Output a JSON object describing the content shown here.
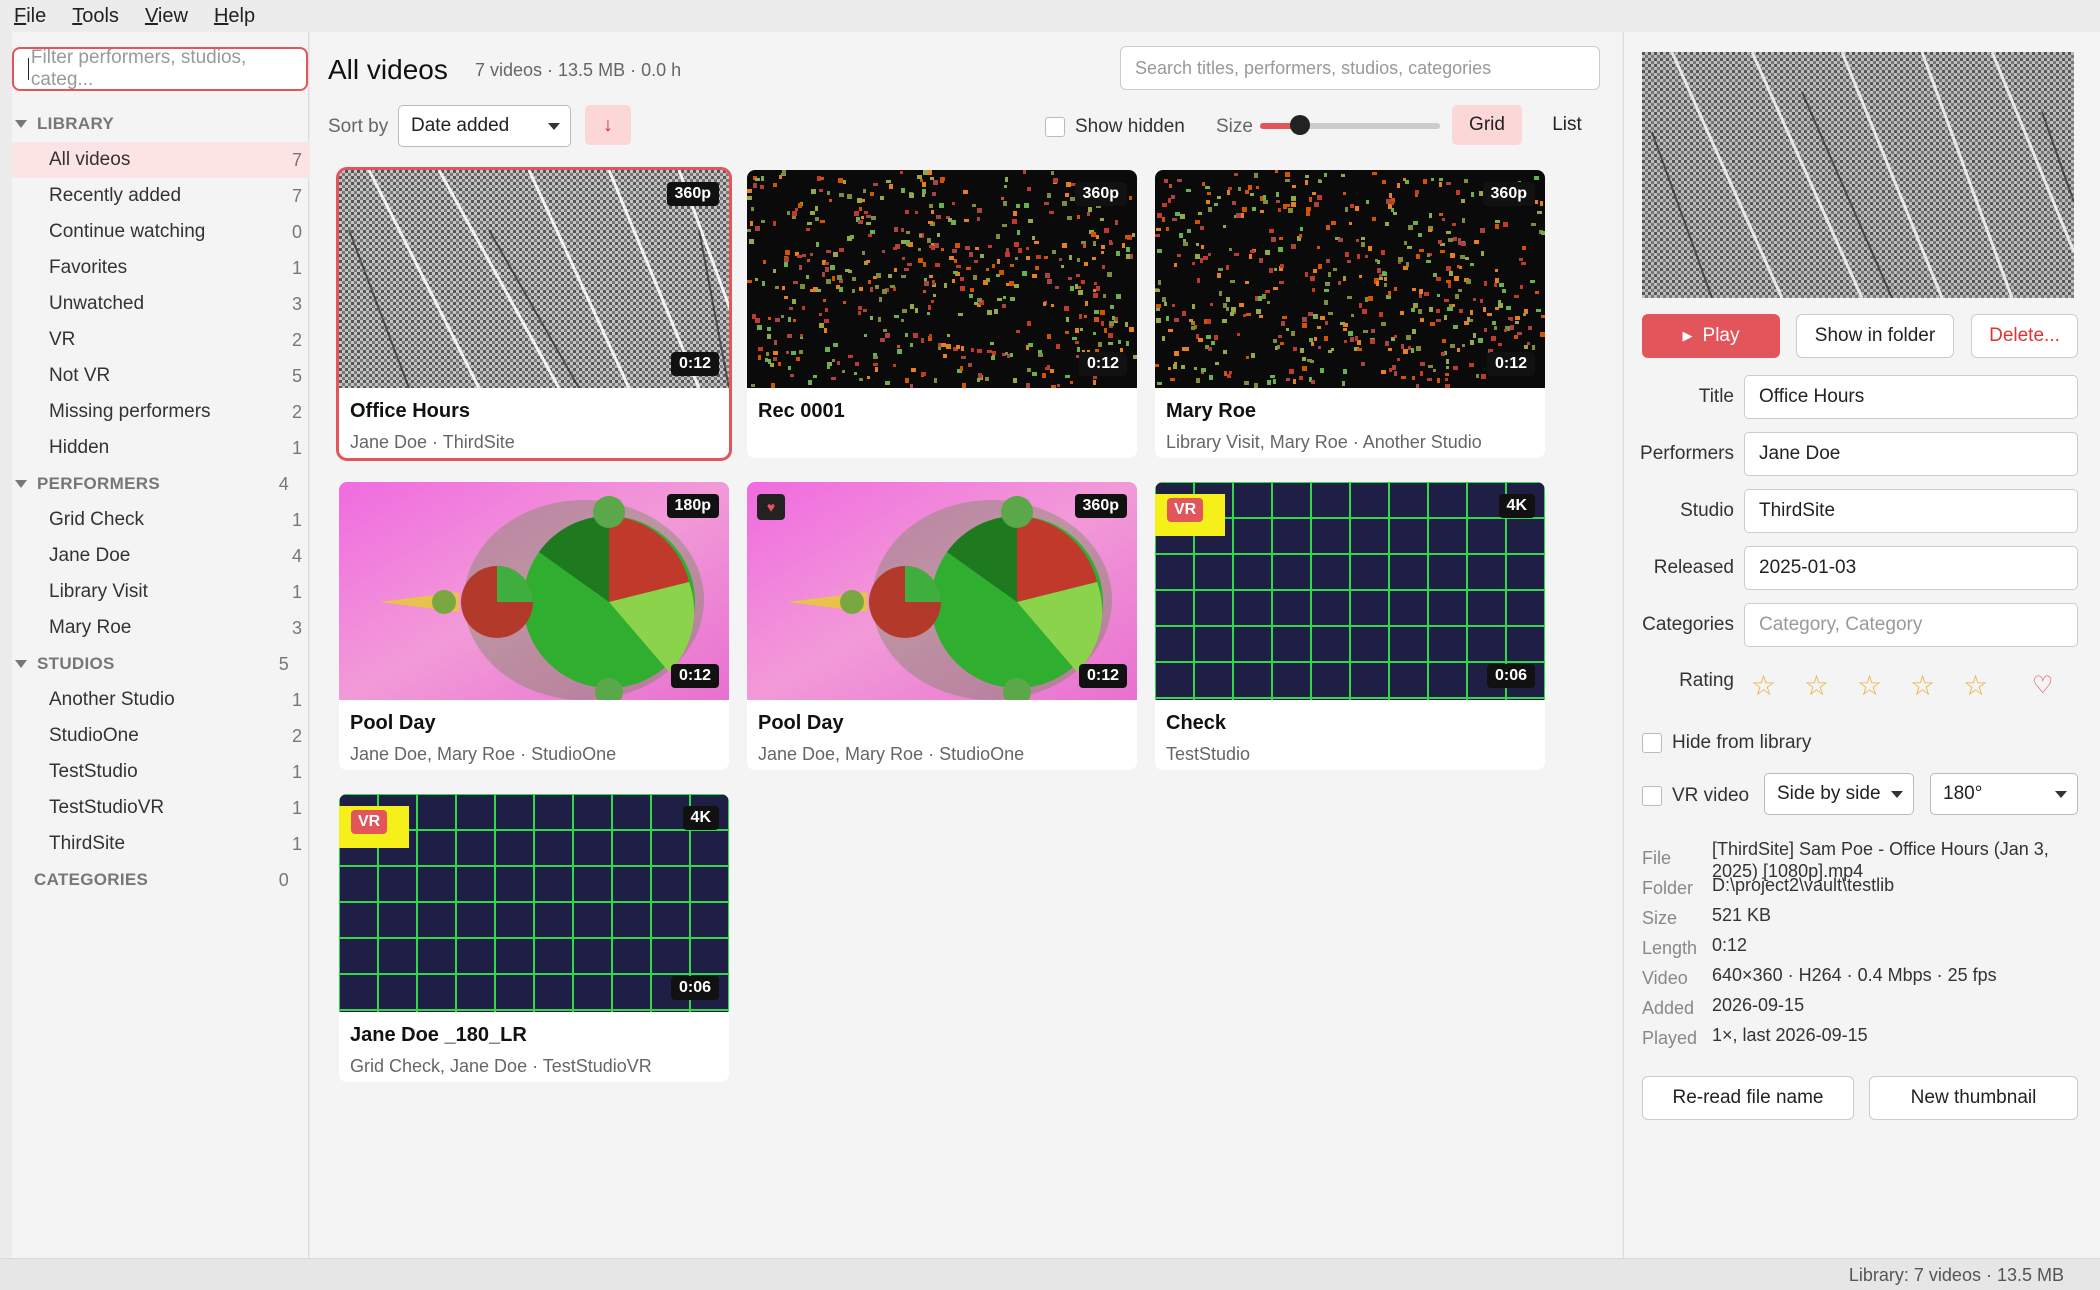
{
  "menu": [
    "File",
    "Tools",
    "View",
    "Help"
  ],
  "sidebar": {
    "filter_placeholder": "Filter performers, studios, categ...",
    "library": {
      "label": "LIBRARY",
      "items": [
        {
          "label": "All videos",
          "count": "7"
        },
        {
          "label": "Recently added",
          "count": "7"
        },
        {
          "label": "Continue watching",
          "count": "0"
        },
        {
          "label": "Favorites",
          "count": "1"
        },
        {
          "label": "Unwatched",
          "count": "3"
        },
        {
          "label": "VR",
          "count": "2"
        },
        {
          "label": "Not VR",
          "count": "5"
        },
        {
          "label": "Missing performers",
          "count": "2"
        },
        {
          "label": "Hidden",
          "count": "1"
        }
      ]
    },
    "performers": {
      "label": "PERFORMERS",
      "count": "4",
      "items": [
        {
          "label": "Grid Check",
          "count": "1"
        },
        {
          "label": "Jane Doe",
          "count": "4"
        },
        {
          "label": "Library Visit",
          "count": "1"
        },
        {
          "label": "Mary Roe",
          "count": "3"
        }
      ]
    },
    "studios": {
      "label": "STUDIOS",
      "count": "5",
      "items": [
        {
          "label": "Another Studio",
          "count": "1"
        },
        {
          "label": "StudioOne",
          "count": "2"
        },
        {
          "label": "TestStudio",
          "count": "1"
        },
        {
          "label": "TestStudioVR",
          "count": "1"
        },
        {
          "label": "ThirdSite",
          "count": "1"
        }
      ]
    },
    "categories": {
      "label": "CATEGORIES",
      "count": "0"
    }
  },
  "main": {
    "title": "All videos",
    "stats": "7 videos · 13.5 MB · 0.0 h",
    "search_placeholder": "Search titles, performers, studios, categories",
    "sort_label": "Sort by",
    "sort_value": "Date added",
    "sort_dir": "↓",
    "show_hidden": "Show hidden",
    "size_label": "Size",
    "size_value": 0.22,
    "grid": "Grid",
    "list": "List",
    "cards": [
      {
        "title": "Office Hours",
        "sub": "Jane Doe · ThirdSite",
        "res": "360p",
        "dur": "0:12",
        "thumb": "noise",
        "selected": true
      },
      {
        "title": "Rec 0001",
        "sub": "",
        "res": "360p",
        "dur": "0:12",
        "thumb": "dots"
      },
      {
        "title": "Mary Roe",
        "sub": "Library Visit, Mary Roe · Another Studio",
        "res": "360p",
        "dur": "0:12",
        "thumb": "dots"
      },
      {
        "title": "Pool Day",
        "sub": "Jane Doe, Mary Roe · StudioOne",
        "res": "180p",
        "dur": "0:12",
        "thumb": "fractal"
      },
      {
        "title": "Pool Day",
        "sub": "Jane Doe, Mary Roe · StudioOne",
        "res": "360p",
        "dur": "0:12",
        "thumb": "fractal",
        "fav": true
      },
      {
        "title": "Check",
        "sub": "TestStudio",
        "res": "4K",
        "dur": "0:06",
        "thumb": "grid",
        "vr": "VR"
      },
      {
        "title": "Jane Doe _180_LR",
        "sub": "Grid Check, Jane Doe · TestStudioVR",
        "res": "4K",
        "dur": "0:06",
        "thumb": "grid",
        "vr": "VR"
      }
    ]
  },
  "details": {
    "play": "Play",
    "show_folder": "Show in folder",
    "delete": "Delete...",
    "fields": [
      {
        "label": "Title",
        "value": "Office Hours"
      },
      {
        "label": "Performers",
        "value": "Jane Doe"
      },
      {
        "label": "Studio",
        "value": "ThirdSite"
      },
      {
        "label": "Released",
        "value": "2025-01-03"
      },
      {
        "label": "Categories",
        "placeholder": "Category, Category"
      }
    ],
    "rating_label": "Rating",
    "rating_value": 0,
    "hide_label": "Hide from library",
    "vr_label": "VR video",
    "vr_layout": "Side by side",
    "vr_angle": "180°",
    "meta": [
      {
        "k": "File",
        "v": "[ThirdSite] Sam Poe - Office Hours (Jan 3, 2025) [1080p].mp4"
      },
      {
        "k": "Folder",
        "v": "D:\\project2\\vault\\testlib"
      },
      {
        "k": "Size",
        "v": "521 KB"
      },
      {
        "k": "Length",
        "v": "0:12"
      },
      {
        "k": "Video",
        "v": "640×360 · H264 · 0.4 Mbps · 25 fps"
      },
      {
        "k": "Added",
        "v": "2026-09-15"
      },
      {
        "k": "Played",
        "v": "1×, last 2026-09-15"
      }
    ],
    "reread": "Re-read file name",
    "new_thumb": "New thumbnail"
  },
  "status": "Library: 7 videos · 13.5 MB",
  "colors": {
    "accent": "#e2555a",
    "accent_light": "#fbd7d7",
    "vr_yellow": "#f6f01a",
    "star": "#e8b13a"
  }
}
